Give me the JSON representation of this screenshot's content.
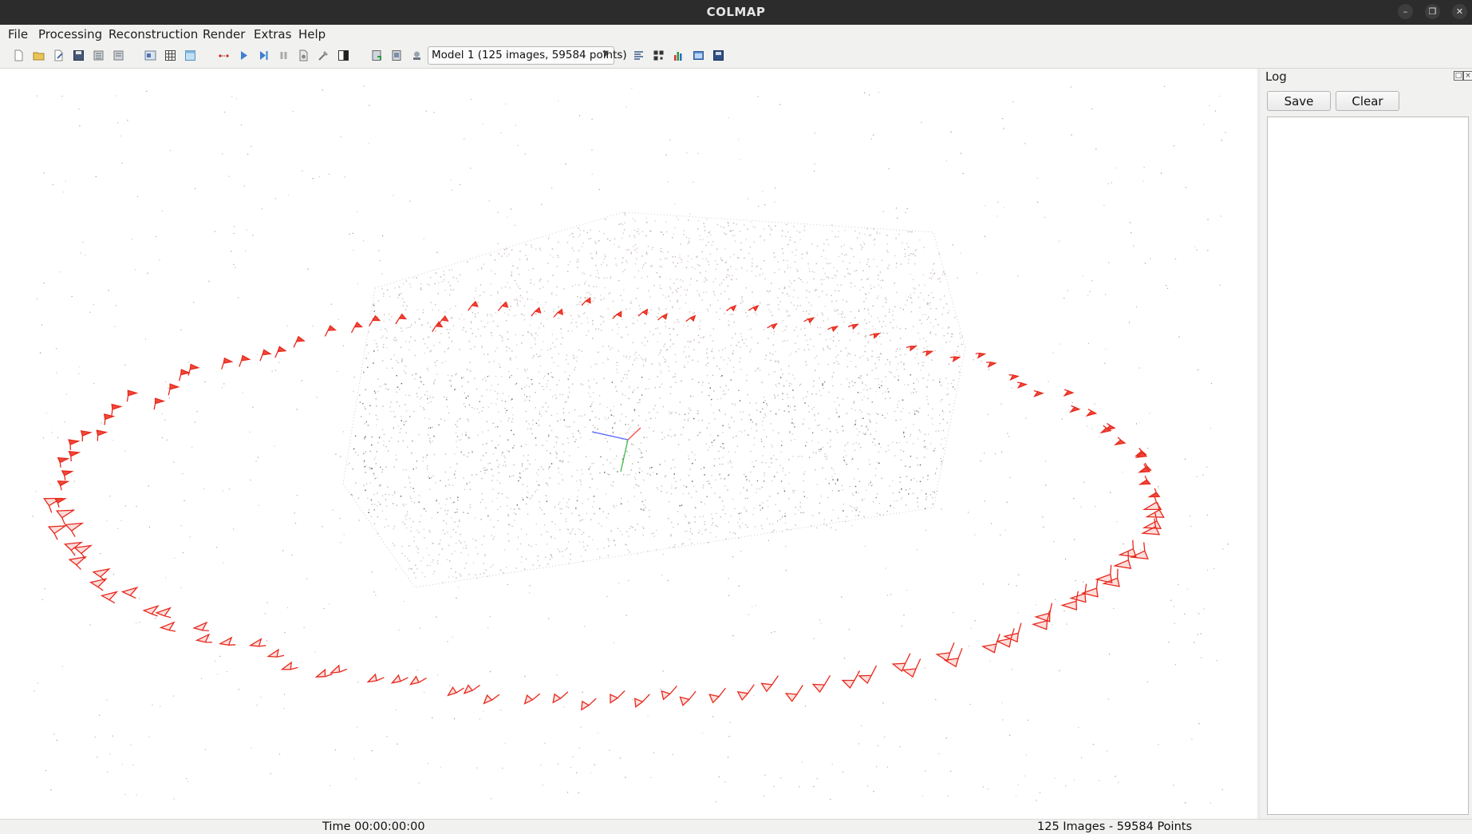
{
  "window": {
    "title": "COLMAP",
    "minimize_icon": "minimize-icon",
    "maximize_icon": "restore-icon",
    "close_icon": "close-icon"
  },
  "menu": [
    "File",
    "Processing",
    "Reconstruction",
    "Render",
    "Extras",
    "Help"
  ],
  "toolbar": {
    "icons": [
      "new-project-icon",
      "open-project-icon",
      "edit-project-icon",
      "save-project-icon",
      "import-model-icon",
      "export-model-icon",
      "feature-extraction-icon",
      "feature-matching-icon",
      "database-management-icon",
      "reconstruction-options-icon",
      "start-reconstruction-icon",
      "step-reconstruction-icon",
      "pause-reconstruction-icon",
      "bundle-adjustment-icon",
      "dense-reconstruction-icon",
      "render-options-icon",
      "undistort-icon",
      "match-matrix-icon",
      "reset-view-icon",
      "model-stats-icon",
      "grab-image-icon",
      "reconstruction-stats-icon",
      "show-log-icon",
      "grab-movie-icon",
      "render-toggle-icon"
    ],
    "model_selector": "Model 1 (125 images, 59584 points)"
  },
  "log": {
    "title": "Log",
    "save_label": "Save",
    "clear_label": "Clear",
    "content": ""
  },
  "status": {
    "time": "Time 00:00:00:00",
    "summary": "125 Images - 59584 Points"
  },
  "colors": {
    "camera": "#e8281c",
    "camera_fill": "#f04a3c",
    "point_light": "#b9a8a2",
    "point_dark": "#3c4a3a"
  }
}
